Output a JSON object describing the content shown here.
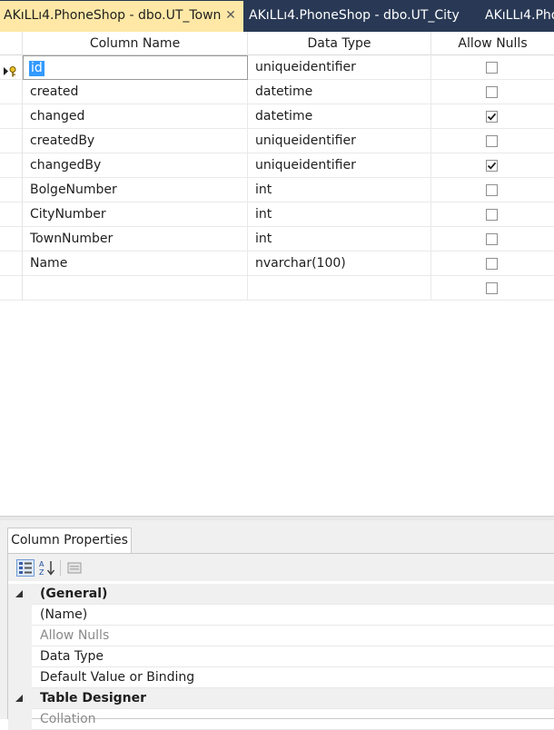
{
  "tabs": [
    {
      "label": "AKıLLı4.PhoneShop - dbo.UT_Town",
      "active": true
    },
    {
      "label": "AKıLLı4.PhoneShop - dbo.UT_City",
      "active": false
    },
    {
      "label": "AKıLLı4.Pho",
      "active": false
    }
  ],
  "grid": {
    "headers": {
      "column_name": "Column Name",
      "data_type": "Data Type",
      "allow_nulls": "Allow Nulls"
    },
    "rows": [
      {
        "name": "id",
        "type": "uniqueidentifier",
        "nulls": false,
        "primary_key": true
      },
      {
        "name": "created",
        "type": "datetime",
        "nulls": false
      },
      {
        "name": "changed",
        "type": "datetime",
        "nulls": true
      },
      {
        "name": "createdBy",
        "type": "uniqueidentifier",
        "nulls": false
      },
      {
        "name": "changedBy",
        "type": "uniqueidentifier",
        "nulls": true
      },
      {
        "name": "BolgeNumber",
        "type": "int",
        "nulls": false
      },
      {
        "name": "CityNumber",
        "type": "int",
        "nulls": false
      },
      {
        "name": "TownNumber",
        "type": "int",
        "nulls": false
      },
      {
        "name": "Name",
        "type": "nvarchar(100)",
        "nulls": false
      },
      {
        "name": "",
        "type": "",
        "nulls": false
      }
    ]
  },
  "properties": {
    "tab_label": "Column Properties",
    "rows": [
      {
        "label": "(General)",
        "kind": "category"
      },
      {
        "label": "(Name)",
        "kind": "item"
      },
      {
        "label": "Allow Nulls",
        "kind": "disabled"
      },
      {
        "label": "Data Type",
        "kind": "item"
      },
      {
        "label": "Default Value or Binding",
        "kind": "item"
      },
      {
        "label": "Table Designer",
        "kind": "category"
      },
      {
        "label": "Collation",
        "kind": "disabled"
      }
    ]
  },
  "colors": {
    "tab_strip": "#293955",
    "active_tab": "#ffe8a6",
    "selection": "#3399ff"
  },
  "icons": [
    "close-icon",
    "primary-key-icon",
    "categorized-sort-icon",
    "alphabetical-sort-icon",
    "property-pages-icon",
    "expand-collapse-icon"
  ]
}
